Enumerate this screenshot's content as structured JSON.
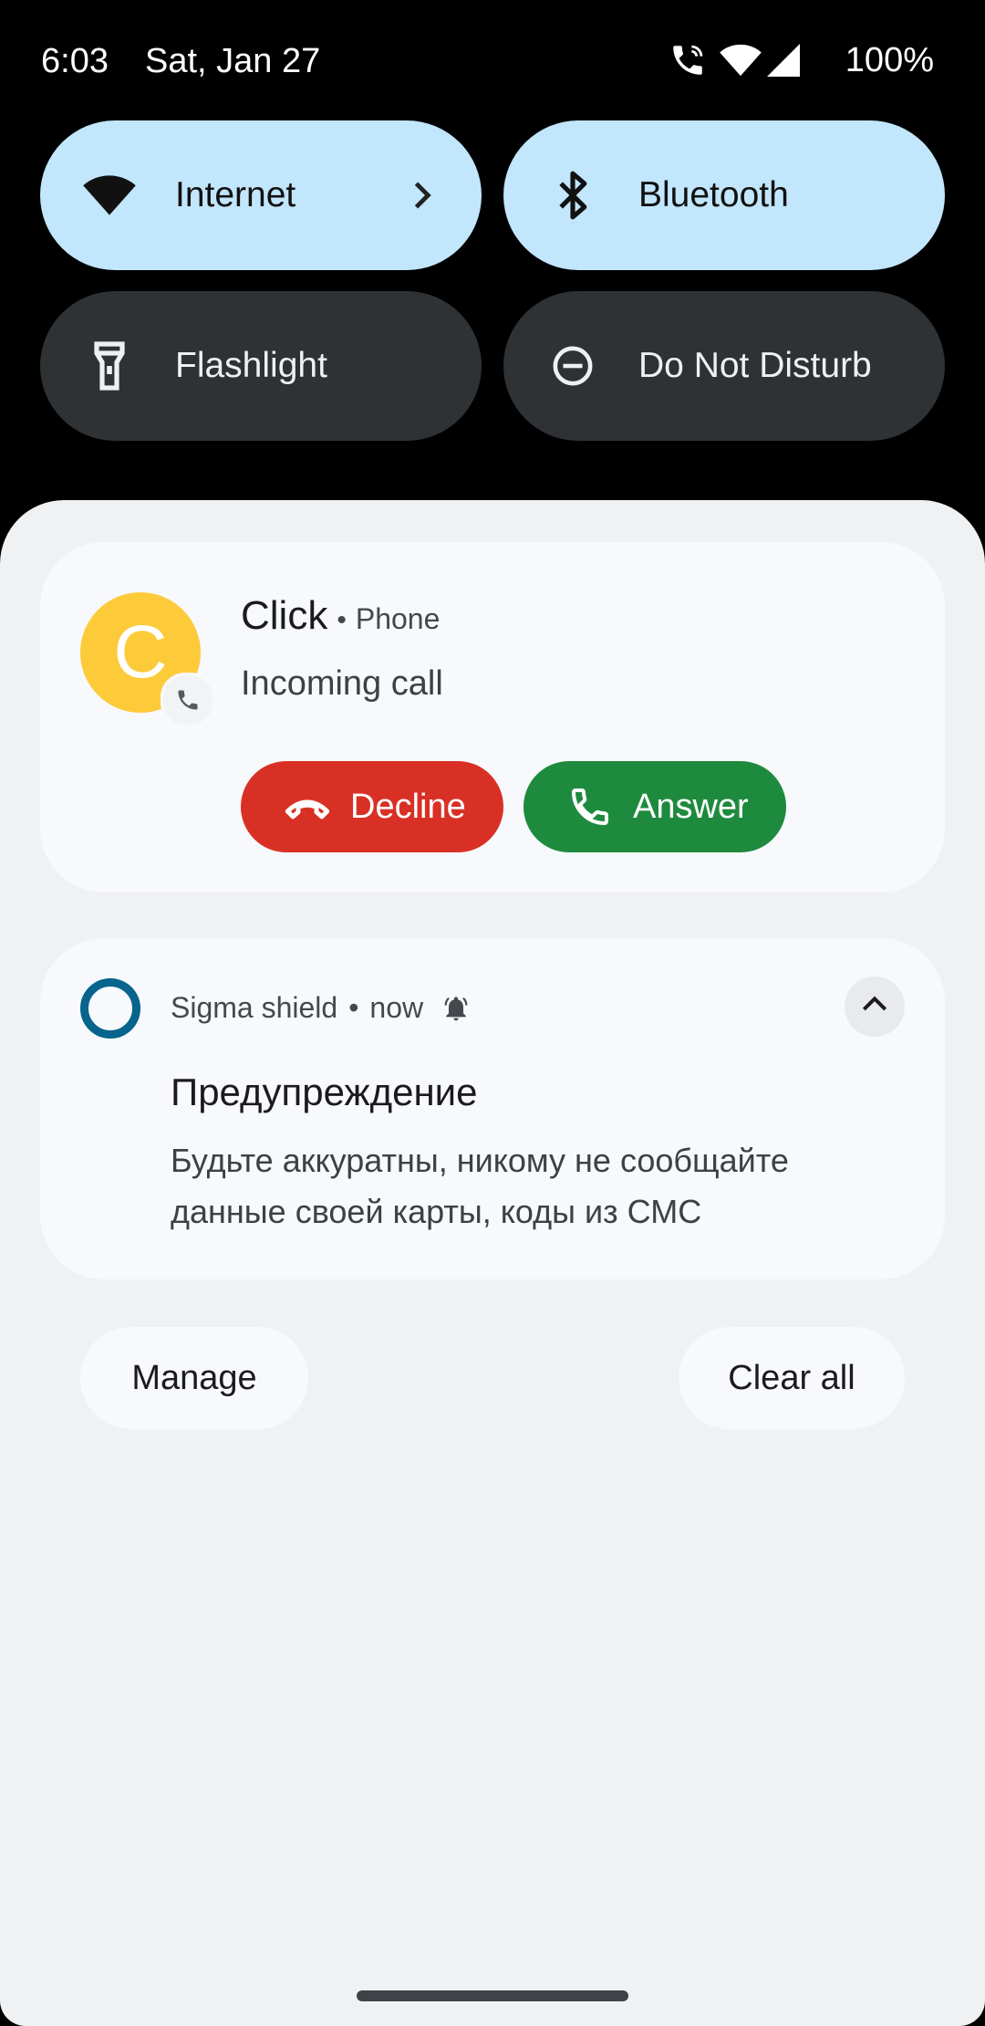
{
  "status_bar": {
    "time": "6:03",
    "date": "Sat, Jan 27",
    "battery": "100%",
    "icons": [
      "call-icon",
      "wifi-icon",
      "cell-signal-icon"
    ]
  },
  "quick_settings": {
    "tiles": [
      {
        "label": "Internet",
        "icon": "wifi-icon",
        "state": "on",
        "has_chevron": true
      },
      {
        "label": "Bluetooth",
        "icon": "bluetooth-icon",
        "state": "on"
      },
      {
        "label": "Flashlight",
        "icon": "flashlight-icon",
        "state": "off"
      },
      {
        "label": "Do Not Disturb",
        "icon": "do-not-disturb-icon",
        "state": "off"
      }
    ]
  },
  "call_notification": {
    "avatar_letter": "C",
    "caller": "Click",
    "separator": "•",
    "app": "Phone",
    "subtitle": "Incoming call",
    "decline_label": "Decline",
    "answer_label": "Answer"
  },
  "alert_notification": {
    "app": "Sigma shield",
    "separator": "•",
    "time": "now",
    "title": "Предупреждение",
    "body": "Будьте аккуратны, никому не сообщайте данные своей карты, коды из СМС"
  },
  "shade_actions": {
    "manage_label": "Manage",
    "clear_label": "Clear all"
  },
  "colors": {
    "tile_active": "#c2e6fb",
    "tile_inactive": "#2f3235",
    "avatar": "#fdca3a",
    "decline": "#d93025",
    "answer": "#1e8a3e",
    "app_ring": "#07648c"
  }
}
